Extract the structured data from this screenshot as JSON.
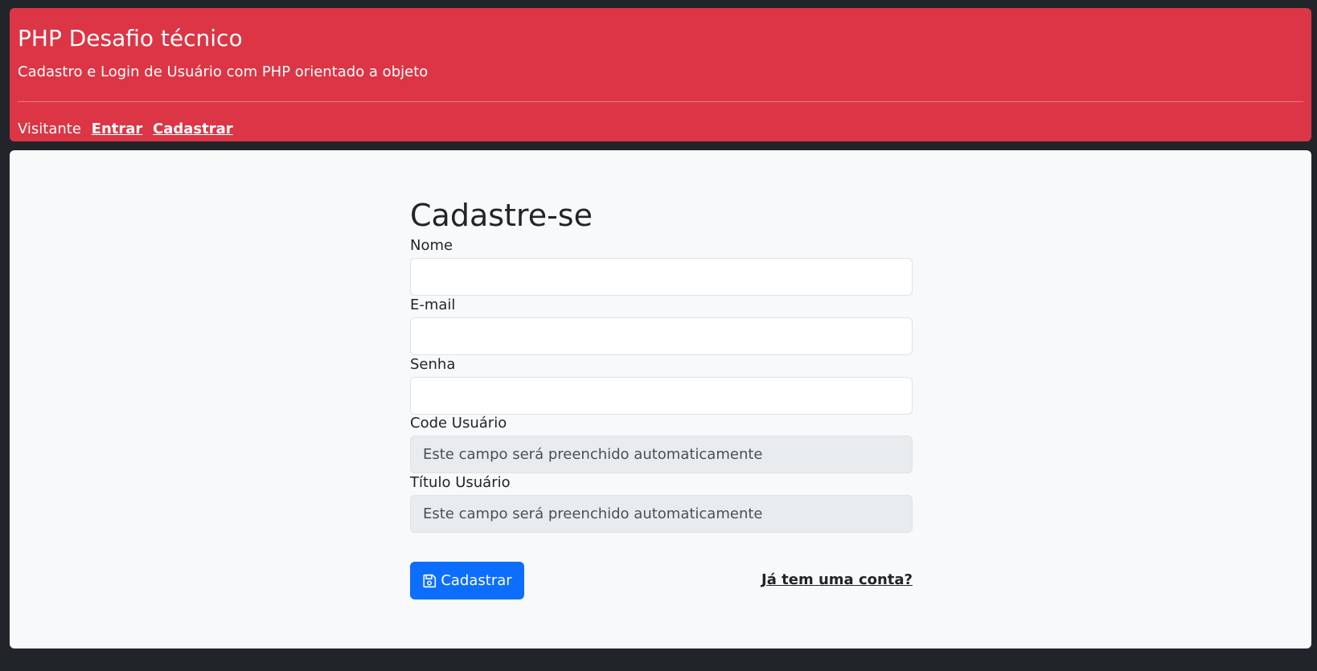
{
  "header": {
    "title": "PHP Desafio técnico",
    "subtitle": "Cadastro e Login de Usuário com PHP orientado a objeto",
    "nav": {
      "status": "Visitante",
      "login_link": "Entrar",
      "register_link": "Cadastrar"
    },
    "background_color": "#dc3545"
  },
  "form": {
    "title": "Cadastre-se",
    "fields": [
      {
        "label": "Nome",
        "value": "",
        "placeholder": ""
      },
      {
        "label": "E-mail",
        "value": "",
        "placeholder": ""
      },
      {
        "label": "Senha",
        "value": "",
        "placeholder": ""
      },
      {
        "label": "Code Usuário",
        "value": "",
        "placeholder": "Este campo será preenchido automaticamente"
      },
      {
        "label": "Título Usuário",
        "value": "",
        "placeholder": "Este campo será preenchido automaticamente"
      }
    ],
    "submit": {
      "label": "Cadastrar",
      "icon": "floppy-disk-icon",
      "color": "#0d6efd"
    },
    "login_link": "Já tem uma conta?"
  },
  "colors": {
    "page_background": "#212529",
    "content_background": "#f8f9fa",
    "readonly_field": "#e9ecef"
  }
}
